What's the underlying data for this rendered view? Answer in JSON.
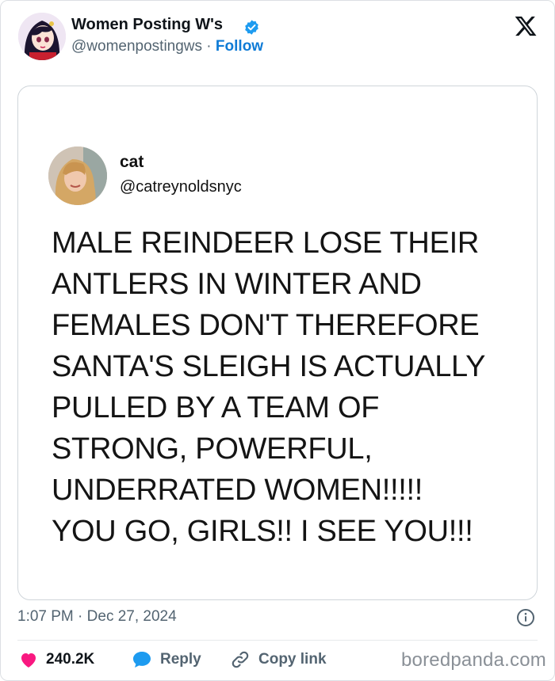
{
  "author": {
    "name": "Women Posting W's",
    "handle": "@womenpostingws",
    "separator": " · ",
    "follow_label": "Follow",
    "verified_icon": "verified-badge-icon",
    "verified_color": "#1d9bf0"
  },
  "brand_icon": "x-logo-icon",
  "embedded_post": {
    "name": "cat",
    "handle": "@catreynoldsnyc",
    "lines": [
      "MALE REINDEER LOSE THEIR",
      "ANTLERS IN WINTER AND",
      "FEMALES DON'T THEREFORE",
      "SANTA'S SLEIGH IS ACTUALLY",
      "PULLED BY A TEAM OF",
      "STRONG, POWERFUL,",
      "UNDERRATED WOMEN!!!!!",
      "YOU GO, GIRLS!! I SEE YOU!!!"
    ]
  },
  "meta": {
    "time": "1:07 PM",
    "separator": " · ",
    "date": "Dec 27, 2024"
  },
  "actions": {
    "likes_count": "240.2K",
    "reply_label": "Reply",
    "copy_label": "Copy link",
    "like_color": "#f91880",
    "reply_color": "#1d9bf0"
  },
  "watermark": "boredpanda.com"
}
